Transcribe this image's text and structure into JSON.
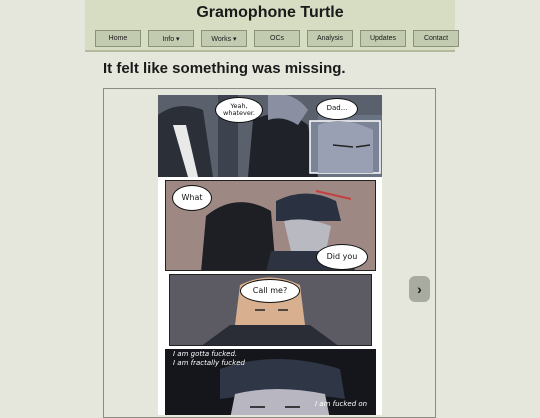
{
  "site": {
    "title": "Gramophone Turtle"
  },
  "nav": {
    "home": "Home",
    "info": "Info ▾",
    "works": "Works ▾",
    "ocs": "OCs",
    "analysis": "Analysis",
    "updates": "Updates",
    "contact": "Contact"
  },
  "page": {
    "title": "It felt like something was missing."
  },
  "comic": {
    "panel1": {
      "bubble1": "Yeah, whatever.",
      "bubble2": "Dad..."
    },
    "panel2": {
      "bubble1": "What",
      "bubble2": "Did you"
    },
    "panel3": {
      "bubble1": "Call me?"
    },
    "panel4": {
      "caption1": "I am gotta fucked.",
      "caption2": "I am fractally fucked",
      "caption3": "I am fucked on"
    }
  },
  "controls": {
    "next": "›"
  },
  "colors": {
    "header": "#d6ddc3",
    "background": "#e6e7dc",
    "nav_button": "#c2cab0"
  }
}
